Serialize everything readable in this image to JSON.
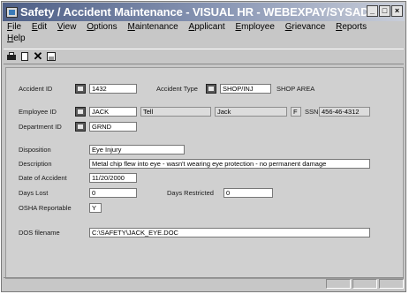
{
  "window": {
    "title": "Safety / Accident Maintenance - VISUAL HR - WEBEXPAY/SYSADM",
    "minimize_label": "_",
    "restore_label": "□",
    "close_label": "×"
  },
  "menu": [
    "File",
    "Edit",
    "View",
    "Options",
    "Maintenance",
    "Applicant",
    "Employee",
    "Grievance",
    "Reports",
    "Help"
  ],
  "toolbar": {
    "icons": [
      "print-icon",
      "new-icon",
      "delete-icon",
      "save-icon"
    ],
    "delete_glyph": "✕"
  },
  "form": {
    "accident_id": {
      "label": "Accident ID",
      "value": "1432"
    },
    "accident_type": {
      "label": "Accident Type",
      "code": "SHOP/INJ",
      "description": "SHOP AREA"
    },
    "employee_id": {
      "label": "Employee ID",
      "value": "JACK",
      "last_name": "Tell",
      "first_name": "Jack",
      "middle_initial": "F",
      "ssn_label": "SSN",
      "ssn": "456-46-4312"
    },
    "department_id": {
      "label": "Department ID",
      "value": "GRND"
    },
    "disposition": {
      "label": "Disposition",
      "value": "Eye Injury"
    },
    "description": {
      "label": "Description",
      "value": "Metal chip flew into eye - wasn't wearing eye protection - no permanent damage"
    },
    "date_of_accident": {
      "label": "Date of Accident",
      "value": "11/20/2000"
    },
    "days_lost": {
      "label": "Days Lost",
      "value": "0"
    },
    "days_restricted": {
      "label": "Days Restricted",
      "value": "0"
    },
    "osha_reportable": {
      "label": "OSHA Reportable",
      "value": "Y"
    },
    "dos_filename": {
      "label": "DOS filename",
      "value": "C:\\SAFETY\\JACK_EYE.DOC"
    }
  },
  "colors": {
    "titlebar_start": "#4e5f86",
    "titlebar_end": "#c9ced9",
    "panel": "#d0d0d0"
  }
}
